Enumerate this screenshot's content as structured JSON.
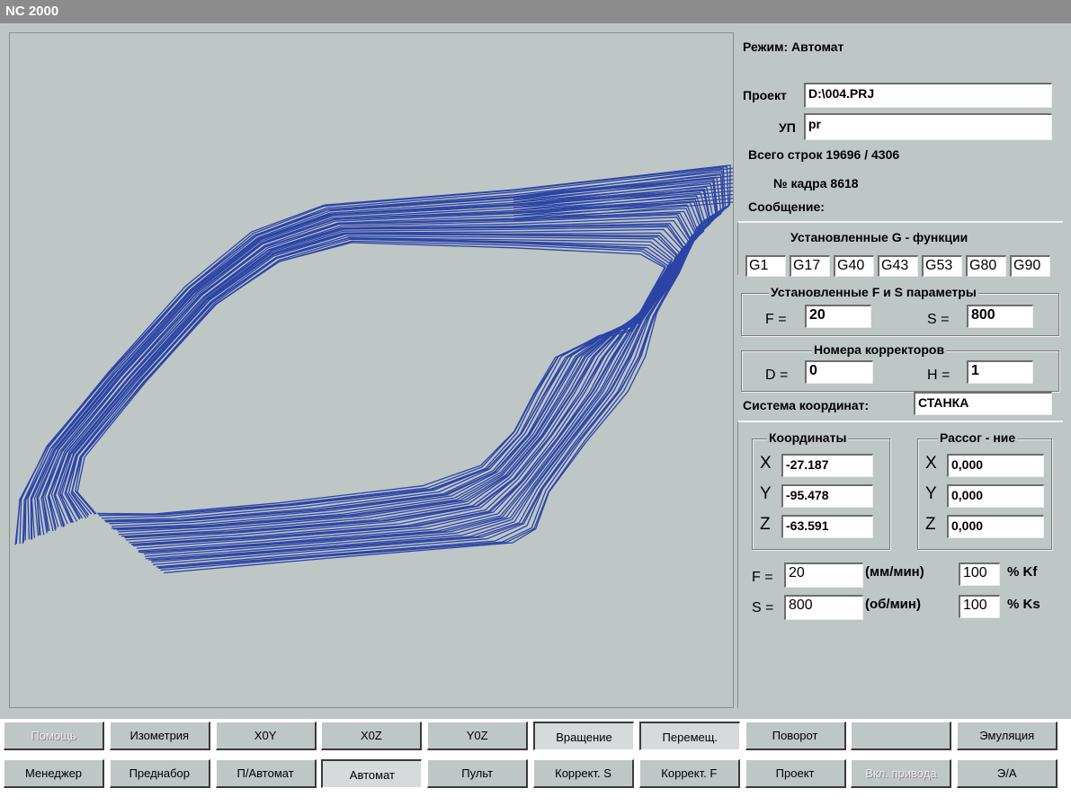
{
  "window": {
    "title": "NC 2000"
  },
  "colors": {
    "toolpath": "#2b44a6",
    "background": "#bfc6c6"
  },
  "status": {
    "mode_label": "Режим: Автомат",
    "project_label": "Проект",
    "project_value": "D:\\004.PRJ",
    "program_label": "УП",
    "program_value": "pr",
    "total_lines": "Всего строк 19696 / 4306",
    "frame_no": "№ кадра  8618",
    "message_label": "Сообщение:"
  },
  "gfunc": {
    "title": "Установленные G - функции",
    "codes": [
      "G1",
      "G17",
      "G40",
      "G43",
      "G53",
      "G80",
      "G90"
    ]
  },
  "fs": {
    "title": "Установленные F и S параметры",
    "f_label": "F =",
    "f_value": "20",
    "s_label": "S =",
    "s_value": "800"
  },
  "corr": {
    "title": "Номера корректоров",
    "d_label": "D =",
    "d_value": "0",
    "h_label": "H =",
    "h_value": "1"
  },
  "coordsys": {
    "label": "Система координат:",
    "value": "СТАНКА"
  },
  "coords": {
    "title": "Координаты",
    "mismatch_title": "Рассог - ние",
    "axes": [
      "X",
      "Y",
      "Z"
    ],
    "values": [
      "-27.187",
      "-95.478",
      "-63.591"
    ],
    "mismatch": [
      "0,000",
      "0,000",
      "0,000"
    ]
  },
  "feed": {
    "f_label": "F =",
    "f_value": "20",
    "f_unit": "(мм/мин)",
    "kf_value": "100",
    "kf_label": "% Kf",
    "s_label": "S =",
    "s_value": "800",
    "s_unit": "(об/мин)",
    "ks_value": "100",
    "ks_label": "% Ks"
  },
  "toolbar_top": [
    "Помощь",
    "Изометрия",
    "X0Y",
    "X0Z",
    "Y0Z",
    "Вращение",
    "Перемещ.",
    "Поворот",
    "",
    "Эмуляция"
  ],
  "toolbar_bottom": [
    "Менеджер",
    "Преднабор",
    "П/Автомат",
    "Автомат",
    "Пульт",
    "Коррект. S",
    "Коррект. F",
    "Проект",
    "Вкл. привода",
    "Э/А"
  ]
}
